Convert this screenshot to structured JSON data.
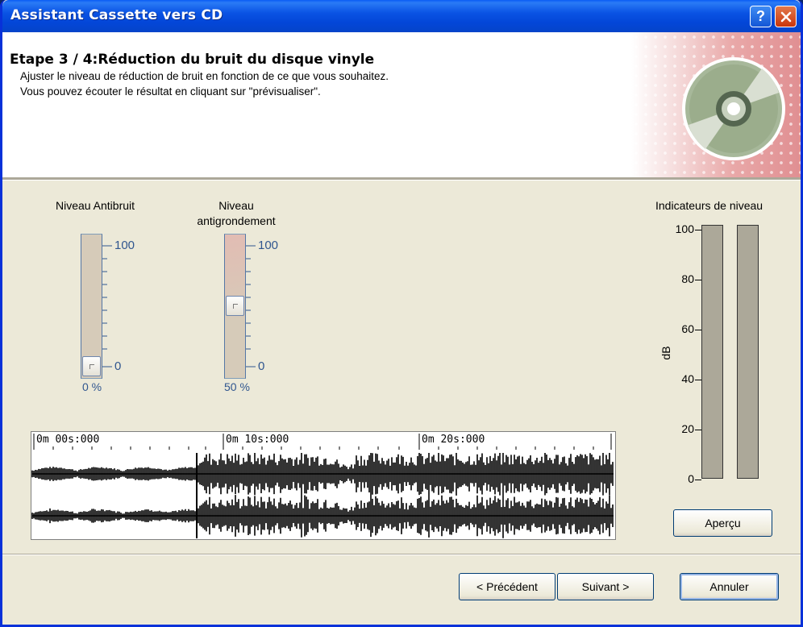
{
  "window": {
    "title": "Assistant Cassette vers CD",
    "help_glyph": "?",
    "close_glyph": "✕"
  },
  "header": {
    "step_title": "Etape 3 / 4:Réduction du bruit du disque vinyle",
    "desc_line1": "Ajuster le niveau de réduction de bruit en fonction de ce que vous souhaitez.",
    "desc_line2": "Vous pouvez écouter le résultat en cliquant sur \"prévisualiser\".",
    "icon": "cd-icon"
  },
  "noise_slider": {
    "label": "Niveau Antibruit",
    "max_label": "100",
    "min_label": "0",
    "value_text": "0 %",
    "value_fraction": 0.0
  },
  "rumble_slider": {
    "label_line1": "Niveau",
    "label_line2": "antigrondement",
    "max_label": "100",
    "min_label": "0",
    "value_text": "50 %",
    "value_fraction": 0.5
  },
  "timeline": {
    "labels": [
      "0m 00s:000",
      "0m 10s:000",
      "0m 20s:000"
    ]
  },
  "level_meters": {
    "title": "Indicateurs de niveau",
    "unit": "dB",
    "scale": [
      "100",
      "80",
      "60",
      "40",
      "20",
      "0"
    ],
    "preview_button": "Aperçu"
  },
  "footer": {
    "prev_button": "< Précédent",
    "next_button": "Suivant >",
    "cancel_button": "Annuler"
  },
  "colors": {
    "title_bar": "#0a53e4",
    "scale_text": "#30568f",
    "header_accent": "#e08f92"
  }
}
